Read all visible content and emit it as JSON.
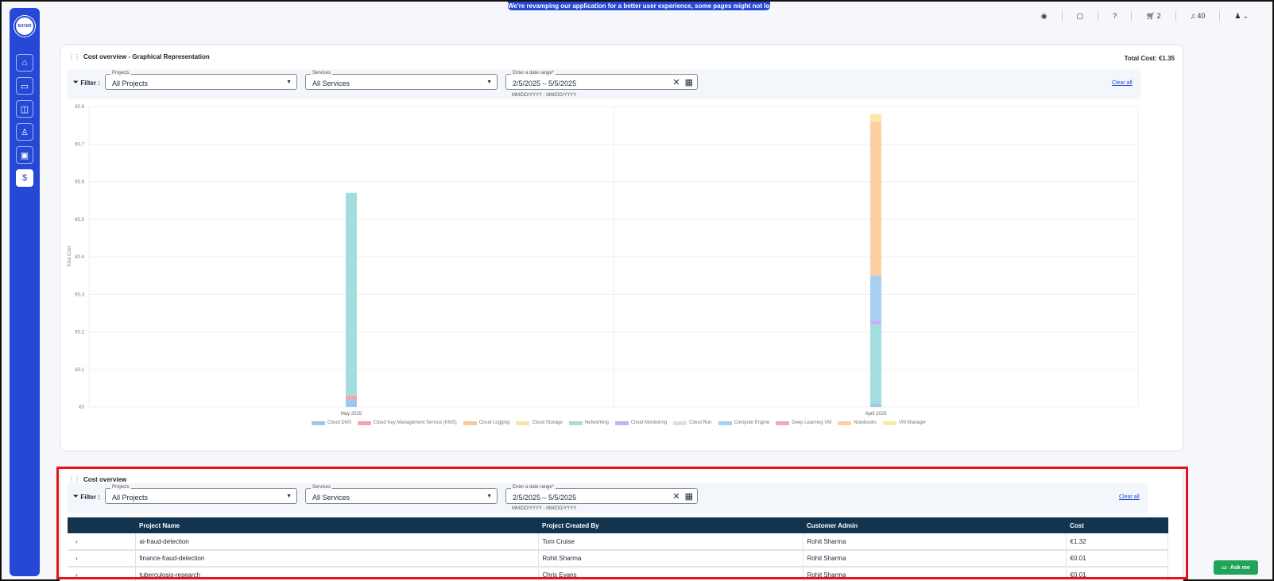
{
  "banner": "We're revamping our application for a better user experience, some pages might not look perfect yet!",
  "logo_text": "BAYER",
  "topbar": {
    "cart_count": "2",
    "notifications_count": "40"
  },
  "chart_card": {
    "title": "Cost overview - Graphical Representation",
    "total_cost": "Total Cost: €1.35",
    "filter": {
      "label": "Filter :",
      "projects_legend": "Projects",
      "projects_value": "All Projects",
      "services_legend": "Services",
      "services_value": "All Services",
      "date_legend": "Enter a date range*",
      "date_value": "2/5/2025  –  5/5/2025",
      "date_hint": "MM/DD/YYYY - MM/DD/YYYY",
      "clear_all": "Clear all"
    }
  },
  "chart_data": {
    "type": "bar",
    "stacked": true,
    "ylabel": "Total Cost",
    "xlabel": "",
    "ylim": [
      0,
      0.8
    ],
    "yticks": [
      "€0",
      "€0.1",
      "€0.2",
      "€0.3",
      "€0.4",
      "€0.5",
      "€0.6",
      "€0.7",
      "€0.8"
    ],
    "categories": [
      "May 2025",
      "April 2025"
    ],
    "grid": true,
    "legend_position": "bottom",
    "series": [
      {
        "name": "Cloud DNS",
        "color": "#9fc9ec",
        "values": [
          0.02,
          0.01
        ]
      },
      {
        "name": "Cloud Key Management Service (KMS)",
        "color": "#f6a3b0",
        "values": [
          0.01,
          0.0
        ]
      },
      {
        "name": "Cloud Logging",
        "color": "#f9c89a",
        "values": [
          0.0,
          0.0
        ]
      },
      {
        "name": "Cloud Storage",
        "color": "#fbe3a8",
        "values": [
          0.0,
          0.0
        ]
      },
      {
        "name": "Networking",
        "color": "#a3dede",
        "values": [
          0.54,
          0.21
        ]
      },
      {
        "name": "Cloud Monitoring",
        "color": "#c4b3f5",
        "values": [
          0.0,
          0.01
        ]
      },
      {
        "name": "Cloud Run",
        "color": "#e0e0e0",
        "values": [
          0.0,
          0.0
        ]
      },
      {
        "name": "Compute Engine",
        "color": "#a8d0f3",
        "values": [
          0.0,
          0.12
        ]
      },
      {
        "name": "Deep Learning VM",
        "color": "#f7a8b8",
        "values": [
          0.0,
          0.0
        ]
      },
      {
        "name": "Notebooks",
        "color": "#fdd0a2",
        "values": [
          0.0,
          0.41
        ]
      },
      {
        "name": "VM Manager",
        "color": "#fde7a7",
        "values": [
          0.0,
          0.02
        ]
      }
    ]
  },
  "table_card": {
    "title": "Cost overview",
    "filter": {
      "label": "Filter :",
      "projects_legend": "Projects",
      "projects_value": "All Projects",
      "services_legend": "Services",
      "services_value": "All Services",
      "date_legend": "Enter a date range*",
      "date_value": "2/5/2025  –  5/5/2025",
      "date_hint": "MM/DD/YYYY - MM/DD/YYYY",
      "clear_all": "Clear all"
    },
    "columns": [
      "Project Name",
      "Project Created By",
      "Customer Admin",
      "Cost"
    ],
    "rows": [
      {
        "name": "ai-fraud-detection",
        "created_by": "Tom Cruise",
        "admin": "Rohit Sharma",
        "cost": "€1.32"
      },
      {
        "name": "finance-fraud-detection",
        "created_by": "Rohit Sharma",
        "admin": "Rohit Sharma",
        "cost": "€0.01"
      },
      {
        "name": "tuberculosis-research",
        "created_by": "Chris Evans",
        "admin": "Rohit Sharma",
        "cost": "€0.01"
      }
    ]
  },
  "ask_me": "Ask me"
}
